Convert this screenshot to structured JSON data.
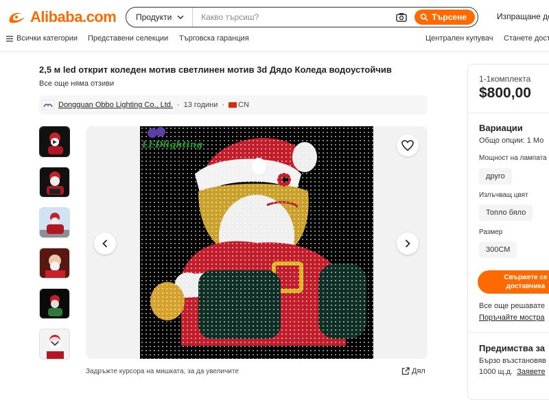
{
  "header": {
    "logo_text": "Alibaba.com",
    "search_category": "Продукти",
    "search_placeholder": "Какво търсиш?",
    "search_button": "Търсене",
    "ship_to": "Изпращане до:"
  },
  "nav": {
    "all_categories": "Всички категории",
    "featured": "Представени селекции",
    "trade_assurance": "Търговска гаранция",
    "buyer_central": "Централен купувач",
    "become_supplier": "Станете дост"
  },
  "product": {
    "title": "2,5 м led открит коледен мотив светлинен мотив 3d Дядо Коледа водоустойчив",
    "reviews": "Все още няма отзиви",
    "supplier_name": "Dongguan Obbo Lighting Co., Ltd.",
    "supplier_years": "13 години",
    "supplier_country": "CN",
    "image_logo_text": "LEDlighting",
    "hover_hint": "Задръжте курсора на мишката, за да увеличите",
    "share_label": "Дял"
  },
  "panel": {
    "qty_range": "1-1комплекта",
    "price": "$800,00",
    "variations_title": "Вариации",
    "total_options": "Общо опции: 1 Мо",
    "power_label": "Мощност на лампата",
    "power_value": "друго",
    "color_label": "Излъчващ цвят",
    "color_value": "Топло бяло",
    "size_label": "Размер",
    "size_value": "300CM",
    "contact_line1": "Свържете се",
    "contact_line2": "доставчика",
    "still_deciding": "Все още решавате",
    "order_sample": "Поръчайте мостра",
    "advantages_title": "Предимства за",
    "fast_refund": "Бързо възстановяв",
    "qty_note": "1000 щ.д.",
    "claim": "Заявете"
  },
  "colors": {
    "accent": "#ff6a00"
  }
}
